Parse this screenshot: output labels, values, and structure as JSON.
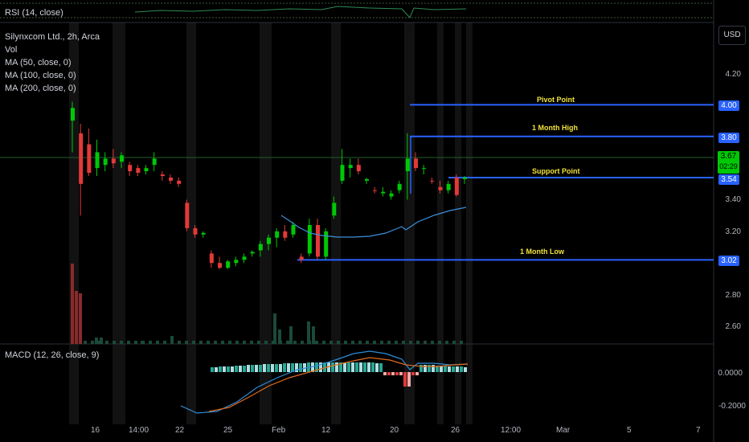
{
  "rsi_pane": {
    "label": "RSI (14, close)"
  },
  "legend": {
    "symbol": "Silynxcom Ltd., 2h, Arca",
    "lines": [
      "Vol",
      "MA (50, close, 0)",
      "MA (100, close, 0)",
      "MA (200, close, 0)"
    ]
  },
  "currency_button": "USD",
  "price_axis": [
    "4.20",
    "4.00",
    "3.80",
    "3.67",
    "3.54",
    "3.40",
    "3.20",
    "3.02",
    "2.80",
    "2.60"
  ],
  "price_axis_plain": [
    "4.20",
    "3.40",
    "3.20",
    "2.80",
    "2.60"
  ],
  "level_tags": [
    {
      "value": "4.00",
      "color": "#2962ff"
    },
    {
      "value": "3.80",
      "color": "#2962ff"
    },
    {
      "value": "3.54",
      "color": "#2962ff"
    },
    {
      "value": "3.02",
      "color": "#2962ff"
    }
  ],
  "last_price": {
    "value": "3.67",
    "countdown": "02:29",
    "color": "#00c805"
  },
  "levels": [
    "Pivot Point",
    "1 Month High",
    "Support Point",
    "1 Month Low"
  ],
  "macd_pane": {
    "label": "MACD (12, 26, close, 9)",
    "axis": [
      "0.0000",
      "-0.2000"
    ]
  },
  "time_axis": [
    "16",
    "14:00",
    "22",
    "25",
    "Feb",
    "12",
    "20",
    "26",
    "12:00",
    "Mar",
    "5",
    "7"
  ],
  "colors": {
    "up": "#00c805",
    "down": "#e33939",
    "level": "#2962ff",
    "ma": "#3d8fd9",
    "signal": "#e06b1f"
  },
  "chart_data": {
    "type": "candlestick",
    "candles": [
      {
        "o": 3.9,
        "h": 4.02,
        "l": 3.7,
        "c": 3.98,
        "up": true
      },
      {
        "o": 3.82,
        "h": 3.88,
        "l": 3.3,
        "c": 3.5,
        "up": false
      },
      {
        "o": 3.75,
        "h": 3.85,
        "l": 3.55,
        "c": 3.57,
        "up": false
      },
      {
        "o": 3.6,
        "h": 3.78,
        "l": 3.55,
        "c": 3.7,
        "up": true
      },
      {
        "o": 3.62,
        "h": 3.7,
        "l": 3.58,
        "c": 3.66,
        "up": true
      },
      {
        "o": 3.66,
        "h": 3.72,
        "l": 3.6,
        "c": 3.63,
        "up": false
      },
      {
        "o": 3.64,
        "h": 3.7,
        "l": 3.6,
        "c": 3.68,
        "up": true
      },
      {
        "o": 3.62,
        "h": 3.64,
        "l": 3.55,
        "c": 3.58,
        "up": false
      },
      {
        "o": 3.6,
        "h": 3.62,
        "l": 3.55,
        "c": 3.57,
        "up": false
      },
      {
        "o": 3.58,
        "h": 3.62,
        "l": 3.56,
        "c": 3.6,
        "up": true
      },
      {
        "o": 3.62,
        "h": 3.7,
        "l": 3.58,
        "c": 3.66,
        "up": true
      },
      {
        "o": 3.56,
        "h": 3.58,
        "l": 3.52,
        "c": 3.55,
        "up": false
      },
      {
        "o": 3.54,
        "h": 3.56,
        "l": 3.5,
        "c": 3.52,
        "up": false
      },
      {
        "o": 3.52,
        "h": 3.54,
        "l": 3.48,
        "c": 3.5,
        "up": false
      },
      {
        "o": 3.38,
        "h": 3.4,
        "l": 3.2,
        "c": 3.22,
        "up": false
      },
      {
        "o": 3.22,
        "h": 3.24,
        "l": 3.16,
        "c": 3.18,
        "up": false
      },
      {
        "o": 3.18,
        "h": 3.2,
        "l": 3.16,
        "c": 3.19,
        "up": true
      },
      {
        "o": 3.06,
        "h": 3.08,
        "l": 2.97,
        "c": 3.0,
        "up": false
      },
      {
        "o": 3.0,
        "h": 3.04,
        "l": 2.96,
        "c": 2.97,
        "up": false
      },
      {
        "o": 2.97,
        "h": 3.02,
        "l": 2.96,
        "c": 3.01,
        "up": true
      },
      {
        "o": 3.0,
        "h": 3.04,
        "l": 2.98,
        "c": 3.02,
        "up": true
      },
      {
        "o": 3.02,
        "h": 3.06,
        "l": 3.0,
        "c": 3.04,
        "up": true
      },
      {
        "o": 3.06,
        "h": 3.08,
        "l": 3.04,
        "c": 3.07,
        "up": true
      },
      {
        "o": 3.08,
        "h": 3.14,
        "l": 3.04,
        "c": 3.12,
        "up": true
      },
      {
        "o": 3.12,
        "h": 3.18,
        "l": 3.08,
        "c": 3.16,
        "up": true
      },
      {
        "o": 3.16,
        "h": 3.22,
        "l": 3.1,
        "c": 3.2,
        "up": true
      },
      {
        "o": 3.2,
        "h": 3.24,
        "l": 3.14,
        "c": 3.16,
        "up": false
      },
      {
        "o": 3.18,
        "h": 3.26,
        "l": 3.16,
        "c": 3.24,
        "up": true
      },
      {
        "o": 3.04,
        "h": 3.06,
        "l": 3.0,
        "c": 3.02,
        "up": false
      },
      {
        "o": 3.06,
        "h": 3.28,
        "l": 3.04,
        "c": 3.24,
        "up": true
      },
      {
        "o": 3.24,
        "h": 3.28,
        "l": 3.02,
        "c": 3.04,
        "up": false
      },
      {
        "o": 3.04,
        "h": 3.22,
        "l": 3.02,
        "c": 3.2,
        "up": true
      },
      {
        "o": 3.3,
        "h": 3.42,
        "l": 3.28,
        "c": 3.38,
        "up": true
      },
      {
        "o": 3.52,
        "h": 3.72,
        "l": 3.5,
        "c": 3.62,
        "up": true
      },
      {
        "o": 3.6,
        "h": 3.66,
        "l": 3.54,
        "c": 3.62,
        "up": true
      },
      {
        "o": 3.62,
        "h": 3.66,
        "l": 3.56,
        "c": 3.58,
        "up": false
      },
      {
        "o": 3.52,
        "h": 3.54,
        "l": 3.5,
        "c": 3.53,
        "up": true
      },
      {
        "o": 3.46,
        "h": 3.48,
        "l": 3.44,
        "c": 3.46,
        "up": false
      },
      {
        "o": 3.44,
        "h": 3.48,
        "l": 3.42,
        "c": 3.45,
        "up": true
      },
      {
        "o": 3.42,
        "h": 3.46,
        "l": 3.4,
        "c": 3.44,
        "up": true
      },
      {
        "o": 3.46,
        "h": 3.52,
        "l": 3.44,
        "c": 3.5,
        "up": true
      },
      {
        "o": 3.58,
        "h": 3.82,
        "l": 3.4,
        "c": 3.66,
        "up": true
      },
      {
        "o": 3.66,
        "h": 3.7,
        "l": 3.58,
        "c": 3.6,
        "up": false
      },
      {
        "o": 3.6,
        "h": 3.62,
        "l": 3.56,
        "c": 3.6,
        "up": true
      },
      {
        "o": 3.52,
        "h": 3.54,
        "l": 3.5,
        "c": 3.52,
        "up": false
      },
      {
        "o": 3.48,
        "h": 3.52,
        "l": 3.44,
        "c": 3.46,
        "up": false
      },
      {
        "o": 3.46,
        "h": 3.52,
        "l": 3.44,
        "c": 3.5,
        "up": true
      },
      {
        "o": 3.54,
        "h": 3.56,
        "l": 3.42,
        "c": 3.43,
        "up": false
      },
      {
        "o": 3.53,
        "h": 3.55,
        "l": 3.5,
        "c": 3.54,
        "up": true
      }
    ],
    "levels": [
      {
        "name": "Pivot Point",
        "price": 4.0
      },
      {
        "name": "1 Month High",
        "price": 3.8
      },
      {
        "name": "Support Point",
        "price": 3.54
      },
      {
        "name": "1 Month Low",
        "price": 3.02
      }
    ],
    "ylim": [
      2.5,
      4.3
    ]
  }
}
